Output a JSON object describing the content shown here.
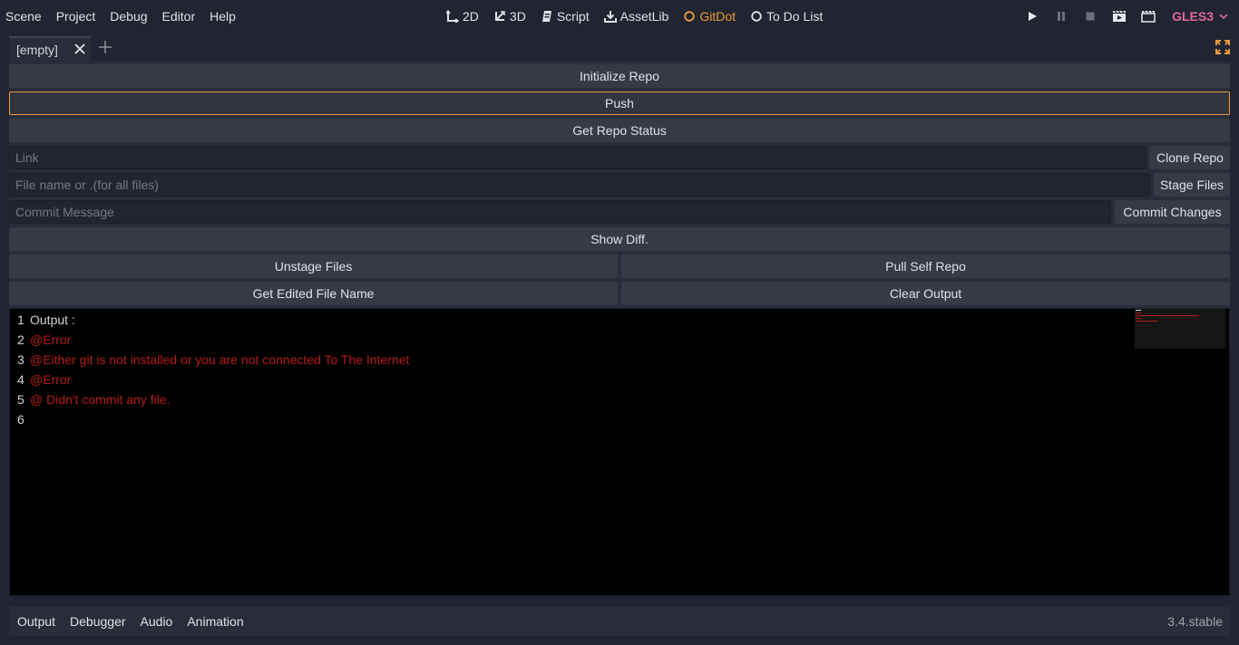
{
  "menu": [
    "Scene",
    "Project",
    "Debug",
    "Editor",
    "Help"
  ],
  "modes": [
    {
      "label": "2D",
      "icon": "2d-move-icon"
    },
    {
      "label": "3D",
      "icon": "3d-move-icon"
    },
    {
      "label": "Script",
      "icon": "script-icon"
    },
    {
      "label": "AssetLib",
      "icon": "download-icon"
    },
    {
      "label": "GitDot",
      "icon": "circle-outline-icon",
      "active": true
    },
    {
      "label": "To Do List",
      "icon": "circle-outline-icon"
    }
  ],
  "renderer": "GLES3",
  "tabs": {
    "current": "[empty]"
  },
  "panel": {
    "init_repo": "Initialize Repo",
    "push": "Push",
    "repo_status": "Get Repo Status",
    "link_placeholder": "Link",
    "clone_repo": "Clone Repo",
    "file_placeholder": "File name or .(for all files)",
    "stage_files": "Stage Files",
    "commit_placeholder": "Commit Message",
    "commit_changes": "Commit Changes",
    "show_diff": "Show Diff.",
    "unstage_files": "Unstage Files",
    "pull_self_repo": "Pull Self Repo",
    "get_edited_file_name": "Get Edited File Name",
    "clear_output": "Clear Output"
  },
  "output": {
    "lines": [
      {
        "n": "1",
        "text": "Output :",
        "error": false
      },
      {
        "n": "2",
        "text": "@Error",
        "error": true
      },
      {
        "n": "3",
        "text": "@Either git is not installed or you are not connected To The Internet",
        "error": true
      },
      {
        "n": "4",
        "text": "@Error",
        "error": true
      },
      {
        "n": "5",
        "text": "@ Didn't commit any file.",
        "error": true
      },
      {
        "n": "6",
        "text": "",
        "error": false
      }
    ]
  },
  "bottom": {
    "tabs": [
      "Output",
      "Debugger",
      "Audio",
      "Animation"
    ],
    "version": "3.4.stable"
  },
  "colors": {
    "accent": "#f09a3c",
    "error": "#b81a1a",
    "renderer": "#e0679a"
  }
}
